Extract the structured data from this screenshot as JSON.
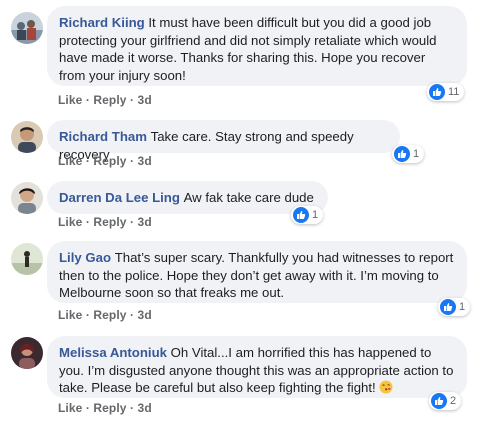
{
  "colors": {
    "author": "#385898",
    "bubble": "#f0f2f5",
    "like_blue": "#1877f2",
    "meta": "#65676b"
  },
  "icons": {
    "like": "thumbs-up-icon",
    "emoji": "kissing-face-emoji"
  },
  "actions": {
    "like": "Like",
    "sep": "·",
    "reply": "Reply"
  },
  "comments": [
    {
      "author": "Richard Kiing",
      "text": "It must have been difficult but you did a good job protecting your girlfriend and did not simply retaliate which would have made it worse. Thanks for sharing this. Hope you recover from your injury soon!",
      "time": "3d",
      "reactions": "11"
    },
    {
      "author": "Richard Tham",
      "text": "Take care. Stay strong and speedy recovery",
      "time": "3d",
      "reactions": "1"
    },
    {
      "author": "Darren Da Lee Ling",
      "text": "Aw fak take care dude",
      "time": "3d",
      "reactions": "1"
    },
    {
      "author": "Lily Gao",
      "text": "That’s super scary. Thankfully you had witnesses to report then to the police. Hope they don’t get away with it. I’m moving to Melbourne soon so that freaks me out.",
      "time": "3d",
      "reactions": "1"
    },
    {
      "author": "Melissa Antoniuk",
      "text": "Oh Vital...I am horrified this has happened to you. I’m disgusted anyone thought this was an appropriate action to take. Please be careful but also keep fighting the fight!",
      "time": "3d",
      "reactions": "2"
    }
  ]
}
